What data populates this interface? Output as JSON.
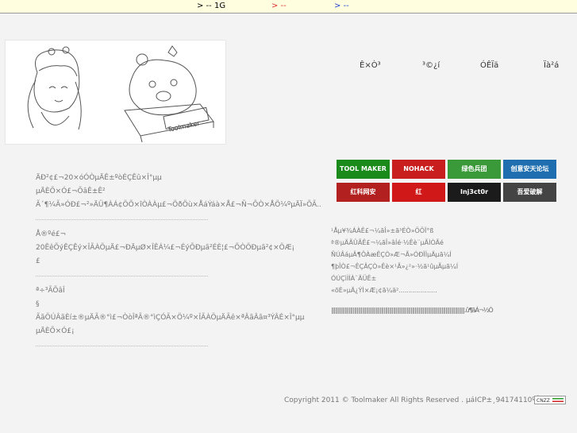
{
  "topbar": {
    "item1": ">    --   1G",
    "item2": ">      --",
    "item3": ">   --"
  },
  "nav": {
    "items": [
      {
        "label": "Ê×Ò³"
      },
      {
        "label": "³©¿í"
      },
      {
        "label": "ÓÊÏä"
      },
      {
        "label": "Ïà²á"
      }
    ]
  },
  "left": {
    "block1": [
      "ÄÐ²¢£¬20×óÓÒµÄÊ±ºòÉÇÊû×Î°µµ",
      "µÄÈÕ×Ó£¬ÕâÊ±Ê²",
      "Ã´¶¼Ã»ÓÐ£¬²»ÄÜ¶ÀÁ¢ÖÕ×îÒÀÀµ£¬ÖðÖù×ÅáÝáà×Å£¬Ñ¬ÕÒ×ÅÖ¼ºµÄÏ»ÕÃ.."
    ],
    "block2": [
      "Å®ºé£¬",
      "20ÊêÕýÊÇÊý×ÎÃÀÖµÄ£¬ÐÄµØ×ÎÊÁ¼£¬ÉýÕÐµã²ÉÈ¦£¬ÕÒÖÐµã²¢×ÖÆ¡",
      "£"
    ],
    "block3": [
      "ª÷³ÃÕâÎ",
      "§",
      "ÃãÖÚÂãÈí±®µÄÃ®°ì£¬ÒòÎªÃ®°ìÇÓÃ×Ö¼º×ÎÃÀÖµÄÃê×ªÂãÂã¤³ÝÂÉ×Î°µµ",
      "µÄÈÕ×Ó£¡"
    ]
  },
  "logos": [
    {
      "label": "TOOL MAKER",
      "color": "#1a8a1a"
    },
    {
      "label": "NOHACK",
      "color": "#c81e1e"
    },
    {
      "label": "绿色兵团",
      "color": "#3a9a3a"
    },
    {
      "label": "创意安天论坛",
      "color": "#1f6fb0"
    },
    {
      "label": "红科网安",
      "color": "#b32020"
    },
    {
      "label": "红",
      "color": "#d01818"
    },
    {
      "label": "Inj3ct0r",
      "color": "#1b1b1b"
    },
    {
      "label": "吾爱破解",
      "color": "#444444"
    }
  ],
  "right": {
    "lines": [
      "¹Åµ¥¾ÁÀÊ£¬¼ãÎ»±ã³ÉÒ»ÖÖÏ°ß",
      "ª®µÄÃÛÃÊ£¬¼ãÎ»âÍé·½Êè¨µÃÌÒÃé",
      "ÑÚÂáµÂ¶ÔÀæÊÇÒ»Æ¬Ã»ÓÐÏÍµÄµã¼Í",
      "¶þÎÒ£¬ÊÇÂÇÒ»Êè×¹Ã»¿²»·½ã¹ûµÃµã¼Í",
      "ÓÚÇìÌÌÀ¨ÄÜÊ±",
      "«õÈ»µÄ¿ÝÌ×Æ¡¢ã¼ä²..................."
    ],
    "bars": "|||||||||||||||||||||||||||||||||||||||||||||||||||||||||||||||||||||||||||||||||||||||||||||||||||.û¶ãÁ¬½Ó"
  },
  "footer": {
    "copyright": "Copyright 2011 © Toolmaker All Rights Reserved .  µáICP±¸94174110ºÅ",
    "badge": "CNZZ"
  }
}
